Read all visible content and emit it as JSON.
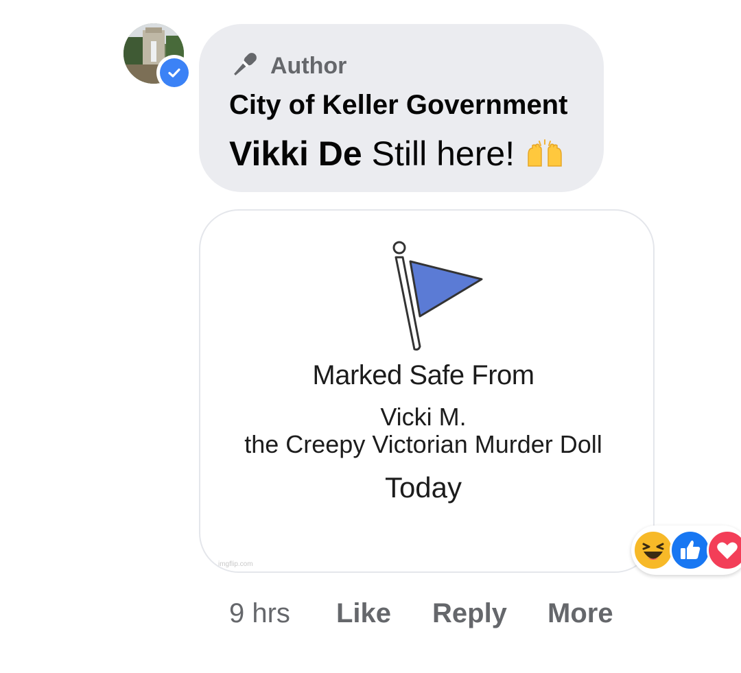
{
  "comment": {
    "author_badge_label": "Author",
    "page_name": "City of Keller Government",
    "mention": "Vikki De",
    "text": "Still here!",
    "emoji": "raising-hands-emoji",
    "verified": true
  },
  "attachment": {
    "title": "Marked Safe From",
    "line1": "Vicki M.",
    "line2": "the Creepy Victorian Murder Doll",
    "date": "Today",
    "watermark": "imgflip.com",
    "flag_color": "#5b7bd5"
  },
  "reactions": [
    {
      "name": "haha-reaction",
      "color": "#f7b928"
    },
    {
      "name": "like-reaction",
      "color": "#1877f2"
    },
    {
      "name": "love-reaction",
      "color": "#f33e58"
    }
  ],
  "actions": {
    "time": "9 hrs",
    "like": "Like",
    "reply": "Reply",
    "more": "More"
  },
  "colors": {
    "bubble": "#ebecf0",
    "secondary_text": "#65676b",
    "verified": "#3b82f6"
  }
}
